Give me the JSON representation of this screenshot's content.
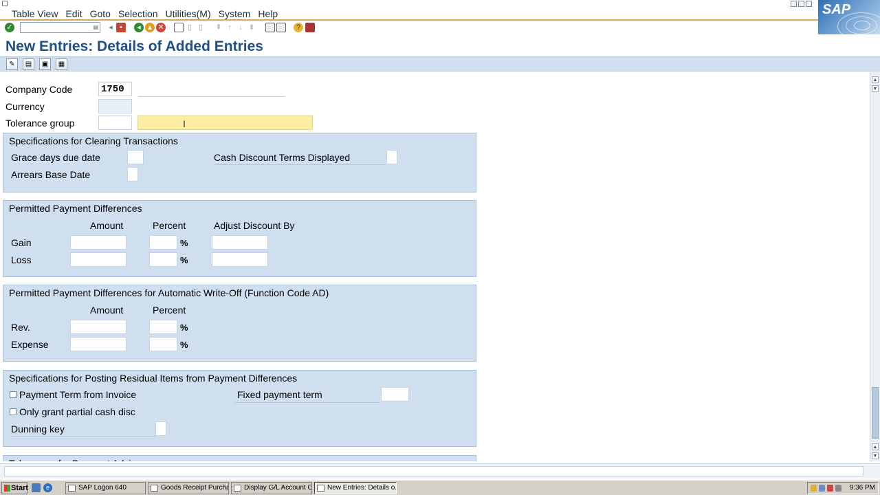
{
  "menu": {
    "items": [
      "Table View",
      "Edit",
      "Goto",
      "Selection",
      "Utilities(M)",
      "System",
      "Help"
    ]
  },
  "brand": {
    "logo": "SAP"
  },
  "std_toolbar": {
    "icons": [
      "enter-icon",
      "back-icon",
      "save-icon",
      "back-green-icon",
      "exit-icon",
      "cancel-icon",
      "print-icon",
      "find-icon",
      "find-next-icon",
      "first-page-icon",
      "prev-page-icon",
      "next-page-icon",
      "last-page-icon",
      "new-session-icon",
      "shortcut-icon",
      "help-icon",
      "layout-icon"
    ]
  },
  "page": {
    "title": "New Entries: Details of Added Entries"
  },
  "app_toolbar": {
    "icons": [
      "change-display-icon",
      "save-variant-icon",
      "copy-entry-icon",
      "delete-entry-icon"
    ]
  },
  "header_fields": {
    "company_code_label": "Company Code",
    "company_code_value": "1750",
    "currency_label": "Currency",
    "currency_value": "",
    "tolerance_group_label": "Tolerance group",
    "tolerance_group_value": "",
    "tolerance_group_desc": ""
  },
  "clearing": {
    "title": "Specifications for Clearing Transactions",
    "grace_days_label": "Grace days due date",
    "cash_discount_label": "Cash Discount Terms Displayed",
    "arrears_label": "Arrears Base Date"
  },
  "payment_diff": {
    "title": "Permitted Payment Differences",
    "col_amount": "Amount",
    "col_percent": "Percent",
    "col_adjust": "Adjust Discount By",
    "rows": [
      {
        "label": "Gain",
        "pct_sign": "%"
      },
      {
        "label": "Loss",
        "pct_sign": "%"
      }
    ]
  },
  "writeoff": {
    "title": "Permitted Payment Differences for Automatic Write-Off (Function Code AD)",
    "col_amount": "Amount",
    "col_percent": "Percent",
    "rows": [
      {
        "label": "Rev.",
        "pct_sign": "%"
      },
      {
        "label": "Expense",
        "pct_sign": "%"
      }
    ]
  },
  "residual": {
    "title": "Specifications for Posting Residual Items from Payment Differences",
    "payment_term_label": "Payment Term from Invoice",
    "payment_term_checked": false,
    "fixed_term_label": "Fixed payment term",
    "partial_cash_label": "Only grant partial cash disc",
    "partial_cash_checked": false,
    "dunning_key_label": "Dunning key"
  },
  "next_group": {
    "title": "Tolerances for Payment Advices"
  },
  "taskbar": {
    "start_label": "Start",
    "tasks": [
      {
        "label": "SAP Logon 640"
      },
      {
        "label": "Goods Receipt Purchase ..."
      },
      {
        "label": "Display G/L Account Cen..."
      },
      {
        "label": "New Entries: Details o..."
      }
    ],
    "clock": "9:36 PM"
  },
  "colors": {
    "accent_title": "#1f4f8b",
    "group_bg": "#cfdff0",
    "highlight_field": "#fbeda3",
    "menu_underline": "#e3a35a"
  }
}
